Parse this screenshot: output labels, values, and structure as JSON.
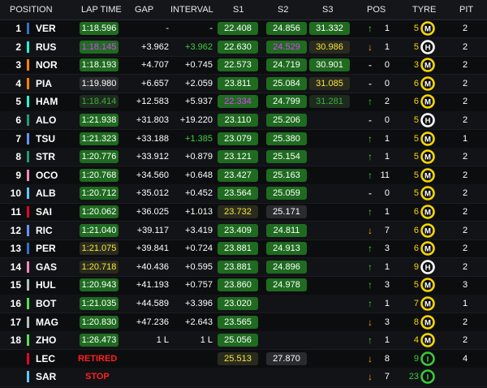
{
  "header": {
    "position": "POSITION",
    "lap_time": "LAP TIME",
    "gap": "GAP",
    "interval": "INTERVAL",
    "s1": "S1",
    "s2": "S2",
    "s3": "S3",
    "pos": "POS",
    "tyre": "TYRE",
    "pit": "PIT"
  },
  "colors": {
    "green_sector": "#1f6b20",
    "purple_text": "#e040ff",
    "yellow_text": "#f5e43c",
    "green_text": "#3fd13f",
    "red_text": "#ff2020",
    "up_arrow": "#31d131",
    "down_arrow": "#f2a516",
    "medium": "#f5d800",
    "hard": "#ffffff",
    "inter": "#3cc83c"
  },
  "rows": [
    {
      "pos": "1",
      "team": "#3671c6",
      "driver": "VER",
      "lap": "1:18.596",
      "lap_style": "g",
      "gap": "-",
      "interval": "-",
      "int_style": "w",
      "s1": "22.408",
      "s1_style": "g",
      "s2": "24.856",
      "s2_style": "g",
      "s3": "31.332",
      "s3_style": "g",
      "arrow": "up",
      "change": "1",
      "age": "5",
      "tyre": "M",
      "pit": "2"
    },
    {
      "pos": "2",
      "team": "#27f4d2",
      "driver": "RUS",
      "lap": "1:18.145",
      "lap_style": "p",
      "gap": "+3.962",
      "interval": "+3.962",
      "int_style": "g",
      "s1": "22.630",
      "s1_style": "g",
      "s2": "24.529",
      "s2_style": "p",
      "s3": "30.986",
      "s3_style": "y",
      "arrow": "down",
      "change": "1",
      "age": "5",
      "tyre": "H",
      "pit": "2"
    },
    {
      "pos": "3",
      "team": "#ff8000",
      "driver": "NOR",
      "lap": "1:18.193",
      "lap_style": "g",
      "gap": "+4.707",
      "interval": "+0.745",
      "int_style": "w",
      "s1": "22.573",
      "s1_style": "g",
      "s2": "24.719",
      "s2_style": "g",
      "s3": "30.901",
      "s3_style": "g",
      "arrow": "none",
      "change": "0",
      "age": "3",
      "tyre": "M",
      "pit": "2"
    },
    {
      "pos": "4",
      "team": "#ff8000",
      "driver": "PIA",
      "lap": "1:19.980",
      "lap_style": "w",
      "gap": "+6.657",
      "interval": "+2.059",
      "int_style": "w",
      "s1": "23.811",
      "s1_style": "g",
      "s2": "25.084",
      "s2_style": "g",
      "s3": "31.085",
      "s3_style": "y",
      "arrow": "none",
      "change": "0",
      "age": "6",
      "tyre": "M",
      "pit": "2"
    },
    {
      "pos": "5",
      "team": "#27f4d2",
      "driver": "HAM",
      "lap": "1:18.414",
      "lap_style": "d",
      "gap": "+12.583",
      "interval": "+5.937",
      "int_style": "w",
      "s1": "22.334",
      "s1_style": "p",
      "s2": "24.799",
      "s2_style": "g",
      "s3": "31.281",
      "s3_style": "d",
      "arrow": "up",
      "change": "2",
      "age": "6",
      "tyre": "M",
      "pit": "2"
    },
    {
      "pos": "6",
      "team": "#229971",
      "driver": "ALO",
      "lap": "1:21.938",
      "lap_style": "g",
      "gap": "+31.803",
      "interval": "+19.220",
      "int_style": "w",
      "s1": "23.110",
      "s1_style": "g",
      "s2": "25.206",
      "s2_style": "g",
      "s3": "",
      "s3_style": "n",
      "arrow": "none",
      "change": "0",
      "age": "5",
      "tyre": "H",
      "pit": "2"
    },
    {
      "pos": "7",
      "team": "#6692ff",
      "driver": "TSU",
      "lap": "1:21.323",
      "lap_style": "g",
      "gap": "+33.188",
      "interval": "+1.385",
      "int_style": "g",
      "s1": "23.079",
      "s1_style": "g",
      "s2": "25.380",
      "s2_style": "g",
      "s3": "",
      "s3_style": "n",
      "arrow": "up",
      "change": "1",
      "age": "5",
      "tyre": "M",
      "pit": "1"
    },
    {
      "pos": "8",
      "team": "#229971",
      "driver": "STR",
      "lap": "1:20.776",
      "lap_style": "g",
      "gap": "+33.912",
      "interval": "+0.879",
      "int_style": "w",
      "s1": "23.121",
      "s1_style": "g",
      "s2": "25.154",
      "s2_style": "g",
      "s3": "",
      "s3_style": "n",
      "arrow": "up",
      "change": "1",
      "age": "5",
      "tyre": "M",
      "pit": "2"
    },
    {
      "pos": "9",
      "team": "#ff87bc",
      "driver": "OCO",
      "lap": "1:20.768",
      "lap_style": "g",
      "gap": "+34.560",
      "interval": "+0.648",
      "int_style": "w",
      "s1": "23.427",
      "s1_style": "g",
      "s2": "25.163",
      "s2_style": "g",
      "s3": "",
      "s3_style": "n",
      "arrow": "up",
      "change": "11",
      "age": "5",
      "tyre": "M",
      "pit": "2"
    },
    {
      "pos": "10",
      "team": "#64c4ff",
      "driver": "ALB",
      "lap": "1:20.712",
      "lap_style": "g",
      "gap": "+35.012",
      "interval": "+0.452",
      "int_style": "w",
      "s1": "23.564",
      "s1_style": "g",
      "s2": "25.059",
      "s2_style": "g",
      "s3": "",
      "s3_style": "n",
      "arrow": "none",
      "change": "0",
      "age": "5",
      "tyre": "M",
      "pit": "2"
    },
    {
      "pos": "11",
      "team": "#e8002d",
      "driver": "SAI",
      "lap": "1:20.062",
      "lap_style": "g",
      "gap": "+36.025",
      "interval": "+1.013",
      "int_style": "w",
      "s1": "23.732",
      "s1_style": "y",
      "s2": "25.171",
      "s2_style": "w",
      "s3": "",
      "s3_style": "n",
      "arrow": "up",
      "change": "1",
      "age": "6",
      "tyre": "M",
      "pit": "2"
    },
    {
      "pos": "12",
      "team": "#6692ff",
      "driver": "RIC",
      "lap": "1:21.040",
      "lap_style": "g",
      "gap": "+39.117",
      "interval": "+3.419",
      "int_style": "w",
      "s1": "23.409",
      "s1_style": "g",
      "s2": "24.811",
      "s2_style": "g",
      "s3": "",
      "s3_style": "n",
      "arrow": "down",
      "change": "7",
      "age": "6",
      "tyre": "M",
      "pit": "2"
    },
    {
      "pos": "13",
      "team": "#3671c6",
      "driver": "PER",
      "lap": "1:21.075",
      "lap_style": "y",
      "gap": "+39.841",
      "interval": "+0.724",
      "int_style": "w",
      "s1": "23.881",
      "s1_style": "g",
      "s2": "24.913",
      "s2_style": "g",
      "s3": "",
      "s3_style": "n",
      "arrow": "up",
      "change": "3",
      "age": "6",
      "tyre": "M",
      "pit": "2"
    },
    {
      "pos": "14",
      "team": "#ff87bc",
      "driver": "GAS",
      "lap": "1:20.718",
      "lap_style": "y",
      "gap": "+40.436",
      "interval": "+0.595",
      "int_style": "w",
      "s1": "23.881",
      "s1_style": "g",
      "s2": "24.896",
      "s2_style": "g",
      "s3": "",
      "s3_style": "n",
      "arrow": "up",
      "change": "1",
      "age": "9",
      "tyre": "H",
      "pit": "2"
    },
    {
      "pos": "15",
      "team": "#b6babd",
      "driver": "HUL",
      "lap": "1:20.943",
      "lap_style": "g",
      "gap": "+41.193",
      "interval": "+0.757",
      "int_style": "w",
      "s1": "23.860",
      "s1_style": "g",
      "s2": "24.978",
      "s2_style": "g",
      "s3": "",
      "s3_style": "n",
      "arrow": "up",
      "change": "3",
      "age": "5",
      "tyre": "M",
      "pit": "3"
    },
    {
      "pos": "16",
      "team": "#52e252",
      "driver": "BOT",
      "lap": "1:21.035",
      "lap_style": "g",
      "gap": "+44.589",
      "interval": "+3.396",
      "int_style": "w",
      "s1": "23.020",
      "s1_style": "g",
      "s2": "",
      "s2_style": "n",
      "s3": "",
      "s3_style": "n",
      "arrow": "up",
      "change": "1",
      "age": "7",
      "tyre": "M",
      "pit": "1"
    },
    {
      "pos": "17",
      "team": "#b6babd",
      "driver": "MAG",
      "lap": "1:20.830",
      "lap_style": "g",
      "gap": "+47.236",
      "interval": "+2.643",
      "int_style": "w",
      "s1": "23.565",
      "s1_style": "g",
      "s2": "",
      "s2_style": "n",
      "s3": "",
      "s3_style": "n",
      "arrow": "down",
      "change": "3",
      "age": "8",
      "tyre": "M",
      "pit": "2"
    },
    {
      "pos": "18",
      "team": "#52e252",
      "driver": "ZHO",
      "lap": "1:26.473",
      "lap_style": "g",
      "gap": "1 L",
      "interval": "1 L",
      "int_style": "w",
      "s1": "25.056",
      "s1_style": "g",
      "s2": "",
      "s2_style": "n",
      "s3": "",
      "s3_style": "n",
      "arrow": "up",
      "change": "1",
      "age": "4",
      "tyre": "M",
      "pit": "2"
    },
    {
      "pos": "",
      "team": "#e8002d",
      "driver": "LEC",
      "status": "RETIRED",
      "lap": "",
      "lap_style": "n",
      "gap": "",
      "interval": "",
      "int_style": "w",
      "s1": "25.513",
      "s1_style": "y",
      "s2": "27.870",
      "s2_style": "w",
      "s3": "",
      "s3_style": "n",
      "arrow": "down",
      "change": "8",
      "age": "9",
      "tyre": "I",
      "pit": "4"
    },
    {
      "pos": "",
      "team": "#64c4ff",
      "driver": "SAR",
      "status": "STOP",
      "lap": "",
      "lap_style": "n",
      "gap": "",
      "interval": "",
      "int_style": "w",
      "s1": "",
      "s1_style": "n",
      "s2": "",
      "s2_style": "n",
      "s3": "",
      "s3_style": "n",
      "arrow": "down",
      "change": "7",
      "age": "23",
      "tyre": "I",
      "pit": ""
    }
  ]
}
